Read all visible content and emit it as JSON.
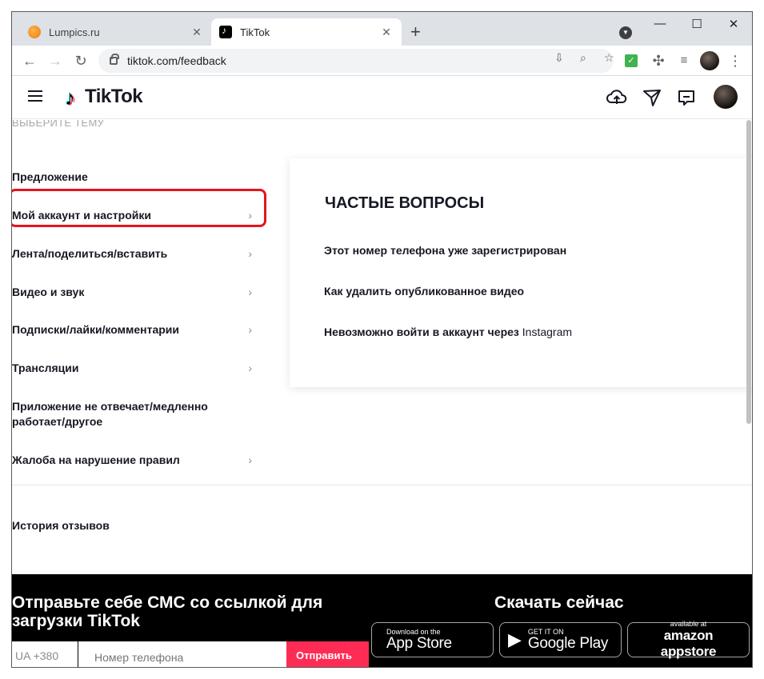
{
  "browser": {
    "tabs": [
      {
        "title": "Lumpics.ru",
        "close": "✕"
      },
      {
        "title": "TikTok",
        "close": "✕"
      }
    ],
    "new_tab": "+",
    "url": "tiktok.com/feedback"
  },
  "header": {
    "logo_text": "TikTok"
  },
  "sidebar": {
    "section_title": "ВЫБЕРИТЕ ТЕМУ",
    "topics": [
      {
        "label": "Предложение"
      },
      {
        "label": "Мой аккаунт и настройки"
      },
      {
        "label": "Лента/поделиться/вставить"
      },
      {
        "label": "Видео и звук"
      },
      {
        "label": "Подписки/лайки/комментарии"
      },
      {
        "label": "Трансляции"
      },
      {
        "label": "Приложение не отвечает/медленно работает/другое"
      },
      {
        "label": "Жалоба на нарушение правил"
      }
    ],
    "history": "История отзывов"
  },
  "faq": {
    "title": "ЧАСТЫЕ ВОПРОСЫ",
    "questions": [
      "Этот номер телефона уже зарегистрирован",
      "Как удалить опубликованное видео",
      "Невозможно войти в аккаунт через"
    ],
    "q3_suffix": "Instagram"
  },
  "footer": {
    "sms_title": "Отправьте себе СМС со ссылкой для загрузки TikTok",
    "download_title": "Скачать сейчас",
    "country_code": "UA +380",
    "phone_placeholder": "Номер телефона",
    "send": "Отправить",
    "stores": [
      {
        "small": "Download on the",
        "big": "App Store"
      },
      {
        "small": "GET IT ON",
        "big": "Google Play"
      },
      {
        "small": "available at",
        "big": "amazon appstore"
      }
    ]
  },
  "colors": {
    "highlight": "#e3151f",
    "send_button": "#fe2c55"
  }
}
